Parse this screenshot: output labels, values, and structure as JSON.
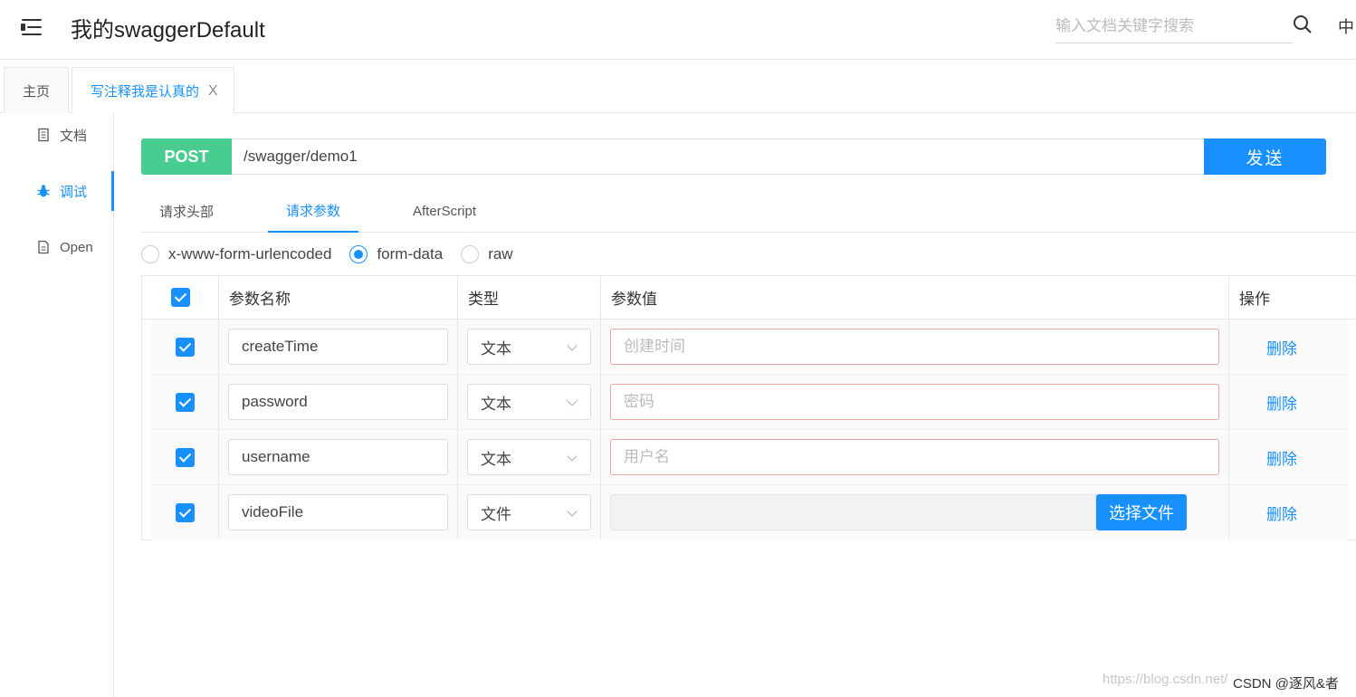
{
  "header": {
    "title": "我的swaggerDefault",
    "search_placeholder": "输入文档关键字搜索",
    "lang": "中"
  },
  "tabs": [
    {
      "label": "主页"
    },
    {
      "label": "写注释我是认真的",
      "close": "X"
    }
  ],
  "sidebar": {
    "items": [
      {
        "label": "文档",
        "icon": "document-icon"
      },
      {
        "label": "调试",
        "icon": "bug-icon",
        "active": true
      },
      {
        "label": "Open",
        "icon": "file-icon"
      }
    ]
  },
  "request": {
    "method": "POST",
    "url": "/swagger/demo1",
    "send_label": "发送"
  },
  "subtabs": [
    "请求头部",
    "请求参数",
    "AfterScript"
  ],
  "body_modes": [
    "x-www-form-urlencoded",
    "form-data",
    "raw"
  ],
  "table": {
    "headers": {
      "name": "参数名称",
      "type": "类型",
      "value": "参数值",
      "op": "操作"
    },
    "rows": [
      {
        "name": "createTime",
        "type": "文本",
        "value_placeholder": "创建时间",
        "op": "删除"
      },
      {
        "name": "password",
        "type": "文本",
        "value_placeholder": "密码",
        "op": "删除"
      },
      {
        "name": "username",
        "type": "文本",
        "value_placeholder": "用户名",
        "op": "删除"
      },
      {
        "name": "videoFile",
        "type": "文件",
        "file_button": "选择文件",
        "op": "删除"
      }
    ]
  },
  "footer": {
    "watermark": "https://blog.csdn.net/",
    "credit": "CSDN @逐风&者"
  },
  "colors": {
    "accent": "#1890ff",
    "post": "#49cc90"
  }
}
